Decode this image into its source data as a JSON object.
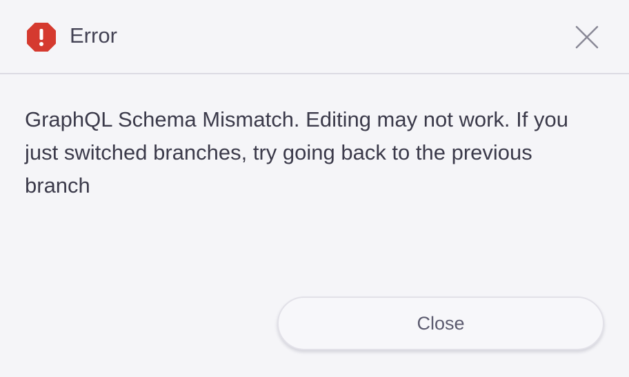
{
  "header": {
    "icon": "error-octagon-icon",
    "icon_color": "#d53a2f",
    "title": "Error",
    "close_icon": "close-icon"
  },
  "body": {
    "message": "GraphQL Schema Mismatch. Editing may not work. If you just switched branches, try going back to the previous branch"
  },
  "footer": {
    "close_label": "Close"
  }
}
